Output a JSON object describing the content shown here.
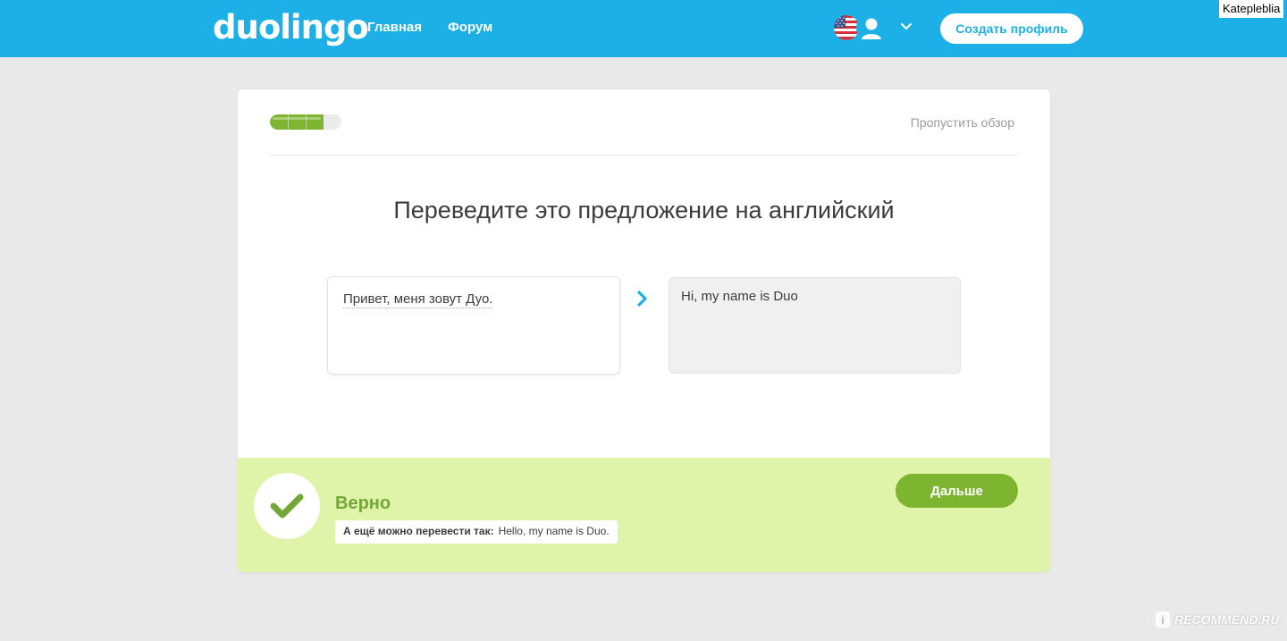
{
  "header": {
    "logo": "duolingo",
    "nav": [
      {
        "label": "Главная"
      },
      {
        "label": "Форум"
      }
    ],
    "create_profile_label": "Создать профиль",
    "language_icon": "us-flag-icon",
    "user_icon": "avatar-icon"
  },
  "lesson": {
    "progress_fraction": 0.75,
    "skip_label": "Пропустить обзор",
    "prompt": "Переведите это предложение на английский",
    "source_sentence": "Привет, меня зовут Дуо.",
    "user_answer": "Hi, my name is Duo"
  },
  "feedback": {
    "verdict": "Верно",
    "alt_label": "А ещё можно перевести так:",
    "alt_translation": "Hello, my name is Duo.",
    "next_label": "Дальше"
  },
  "watermarks": {
    "top": "Katepleblia",
    "bottom": "RECOMMEND.RU"
  },
  "colors": {
    "brand_blue": "#1cb0e6",
    "accent_green": "#7eb530",
    "feedback_bg": "#dff3a9",
    "verdict_green": "#73a838"
  }
}
